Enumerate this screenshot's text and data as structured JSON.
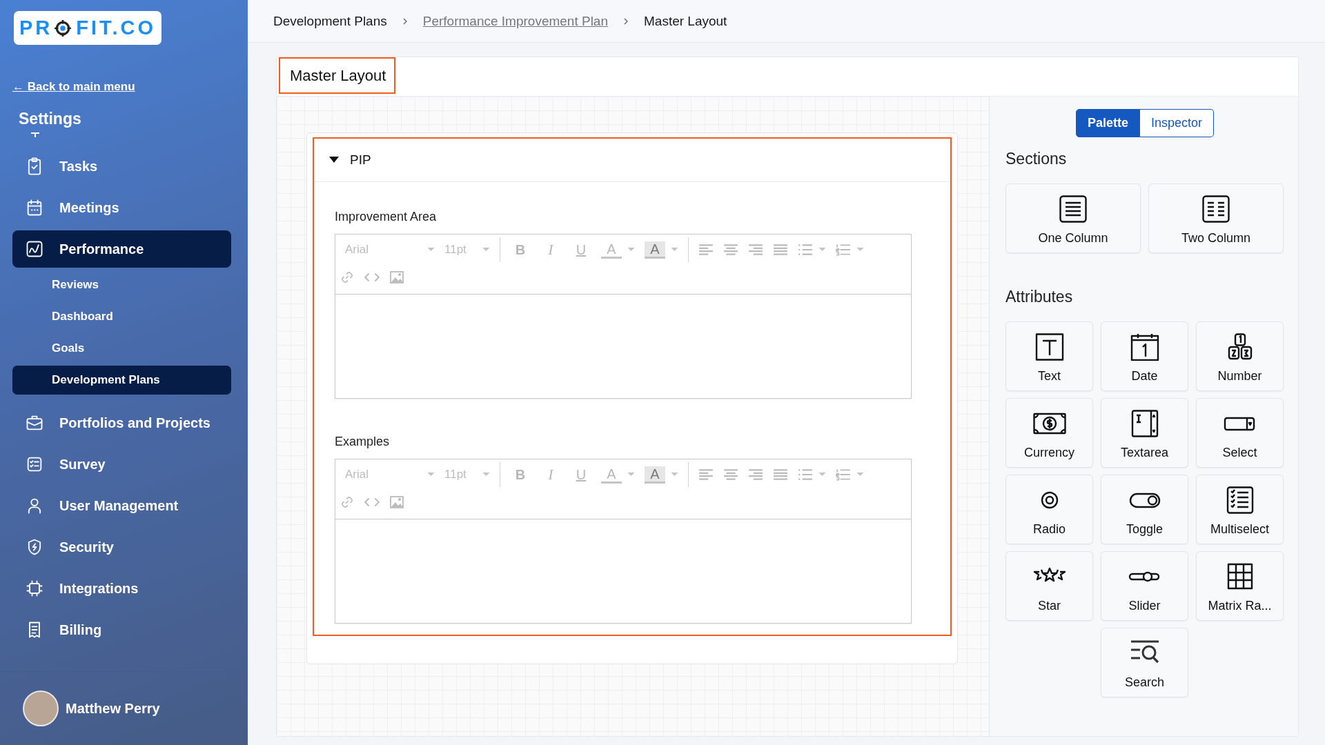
{
  "logo": {
    "parts": [
      "PR",
      "FIT.CO"
    ]
  },
  "back_link": "← Back to main menu",
  "sidebar": {
    "heading": "Settings",
    "items": [
      {
        "label": "Tasks",
        "selected": false
      },
      {
        "label": "Meetings",
        "selected": false
      },
      {
        "label": "Performance",
        "selected": true,
        "children": [
          {
            "label": "Reviews",
            "selected": false
          },
          {
            "label": "Dashboard",
            "selected": false
          },
          {
            "label": "Goals",
            "selected": false
          },
          {
            "label": "Development Plans",
            "selected": true
          }
        ]
      },
      {
        "label": "Portfolios and Projects",
        "selected": false
      },
      {
        "label": "Survey",
        "selected": false
      },
      {
        "label": "User Management",
        "selected": false
      },
      {
        "label": "Security",
        "selected": false
      },
      {
        "label": "Integrations",
        "selected": false
      },
      {
        "label": "Billing",
        "selected": false
      }
    ]
  },
  "user": {
    "name": "Matthew Perry"
  },
  "breadcrumb": [
    {
      "label": "Development Plans",
      "kind": "page"
    },
    {
      "label": "Performance Improvement Plan",
      "kind": "link"
    },
    {
      "label": "Master Layout",
      "kind": "page"
    }
  ],
  "layout": {
    "title": "Master Layout",
    "section": {
      "title": "PIP",
      "expanded": true,
      "fields": [
        {
          "label": "Improvement Area",
          "toolbar": {
            "font": "Arial",
            "size": "11pt",
            "bold": "B",
            "italic": "I",
            "underline": "U",
            "font_color": "A",
            "highlight": "A"
          }
        },
        {
          "label": "Examples",
          "toolbar": {
            "font": "Arial",
            "size": "11pt",
            "bold": "B",
            "italic": "I",
            "underline": "U",
            "font_color": "A",
            "highlight": "A"
          }
        }
      ]
    }
  },
  "palette": {
    "tabs": [
      {
        "label": "Palette",
        "selected": true
      },
      {
        "label": "Inspector",
        "selected": false
      }
    ],
    "sections_heading": "Sections",
    "sections": [
      "One Column",
      "Two Column"
    ],
    "attributes_heading": "Attributes",
    "attributes": [
      "Text",
      "Date",
      "Number",
      "Currency",
      "Textarea",
      "Select",
      "Radio",
      "Toggle",
      "Multiselect",
      "Star",
      "Slider",
      "Matrix Ra...",
      "Search"
    ]
  }
}
